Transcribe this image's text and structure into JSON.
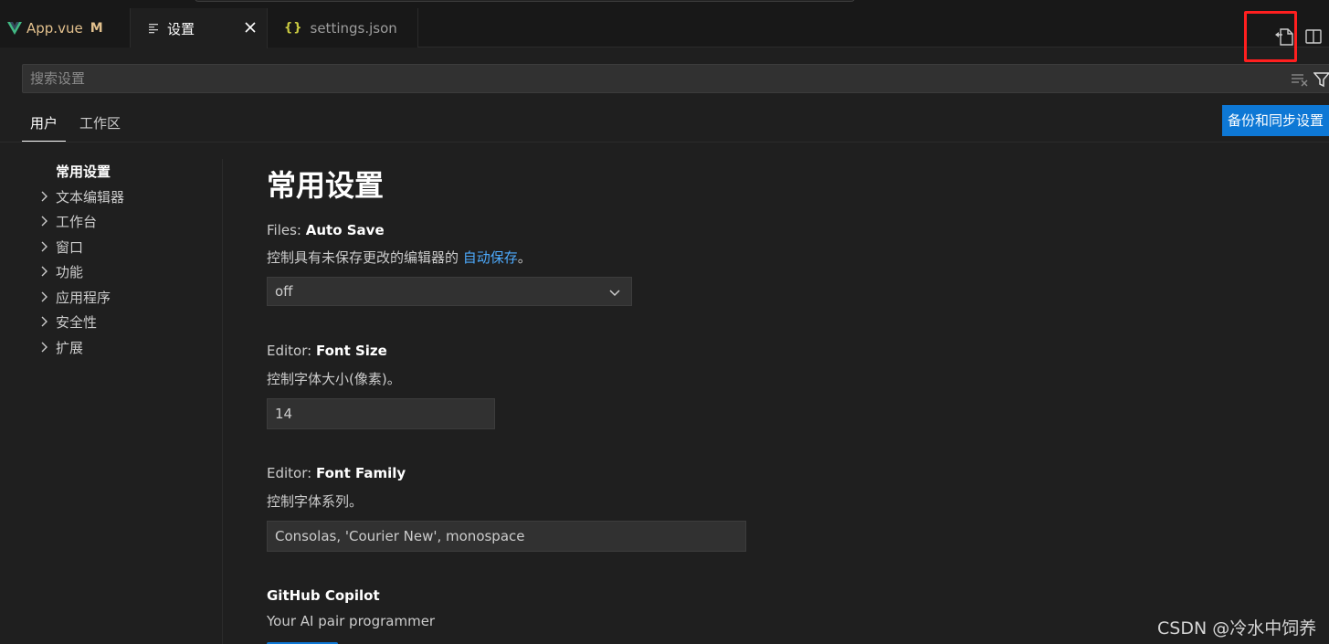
{
  "tabs": [
    {
      "label": "App.vue",
      "badge": "M",
      "icon": "vue-icon"
    },
    {
      "label": "设置",
      "icon": "settings-lines-icon",
      "active": true
    },
    {
      "label": "settings.json",
      "icon": "braces-icon",
      "glyph": "{}"
    }
  ],
  "search": {
    "placeholder": "搜索设置"
  },
  "scopes": {
    "user": "用户",
    "workspace": "工作区"
  },
  "sync_button": "备份和同步设置",
  "toc": {
    "head": "常用设置",
    "items": [
      "文本编辑器",
      "工作台",
      "窗口",
      "功能",
      "应用程序",
      "安全性",
      "扩展"
    ]
  },
  "section_title": "常用设置",
  "settings": {
    "auto_save": {
      "category": "Files: ",
      "name": "Auto Save",
      "desc_prefix": "控制具有未保存更改的编辑器的 ",
      "desc_link": "自动保存",
      "desc_suffix": "。",
      "value": "off"
    },
    "font_size": {
      "category": "Editor: ",
      "name": "Font Size",
      "desc": "控制字体大小(像素)。",
      "value": "14"
    },
    "font_family": {
      "category": "Editor: ",
      "name": "Font Family",
      "desc": "控制字体系列。",
      "value": "Consolas, 'Courier New', monospace"
    },
    "copilot": {
      "name": "GitHub Copilot",
      "desc": "Your AI pair programmer"
    }
  },
  "watermark": "CSDN @冷水中饲养",
  "colors": {
    "accent": "#0e78d5",
    "link": "#4daafc",
    "modified": "#e2c08d",
    "highlight_box": "#ff1f1f"
  }
}
